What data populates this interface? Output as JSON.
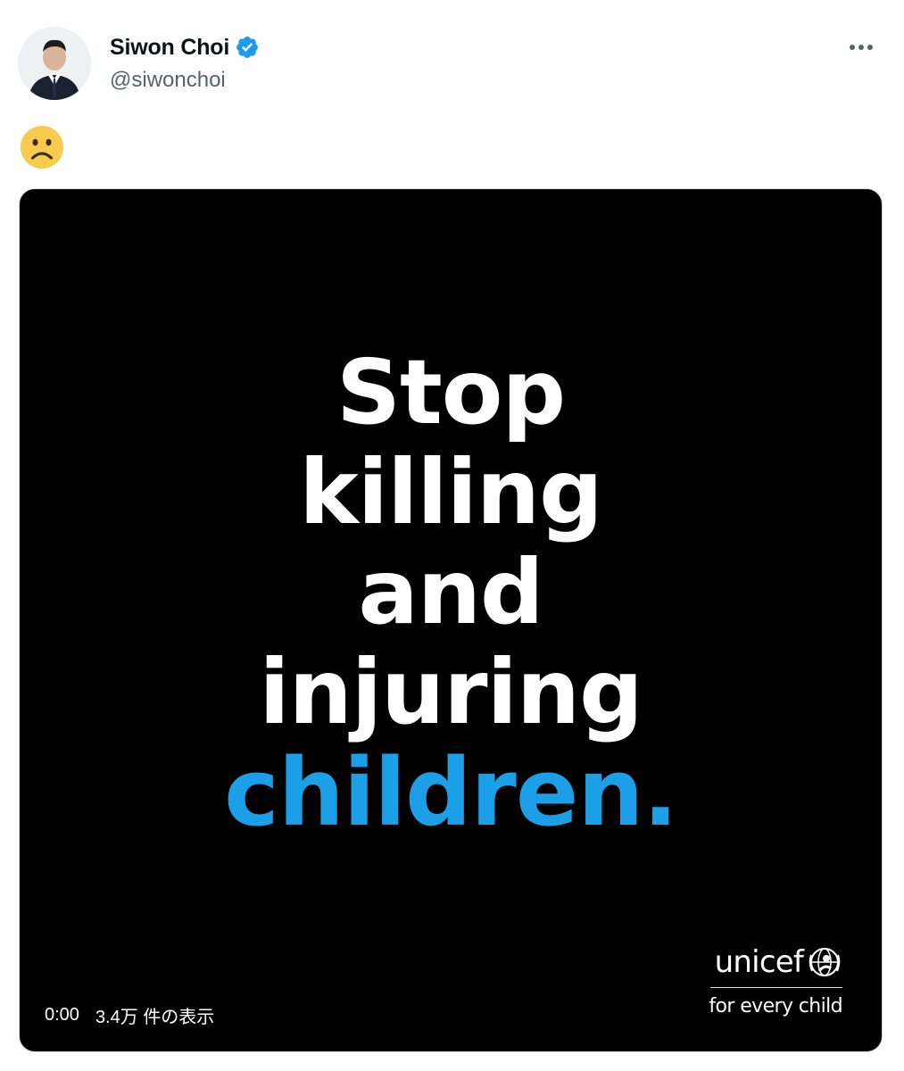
{
  "tweet": {
    "author": {
      "display_name": "Siwon Choi",
      "handle": "@siwonchoi",
      "verified": true
    },
    "text_emoji": "🙁",
    "more_icon": "more-horizontal-icon"
  },
  "media": {
    "poster_lines": [
      "Stop",
      "killing",
      "and",
      "injuring",
      "children."
    ],
    "accent_color": "#1ba0e8",
    "brand": "unicef",
    "tagline": "for every child",
    "time": "0:00",
    "views": "3.4万 件の表示"
  },
  "colors": {
    "verified_blue": "#1d9bf0",
    "text_primary": "#0f1419",
    "text_secondary": "#536471"
  }
}
